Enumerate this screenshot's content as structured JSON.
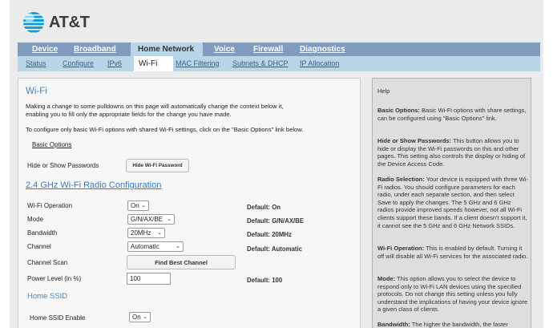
{
  "brand": {
    "name": "AT&T"
  },
  "nav_primary": [
    {
      "label": "Device",
      "active": false
    },
    {
      "label": "Broadband",
      "active": false
    },
    {
      "label": "Home Network",
      "active": true
    },
    {
      "label": "Voice",
      "active": false
    },
    {
      "label": "Firewall",
      "active": false
    },
    {
      "label": "Diagnostics",
      "active": false
    }
  ],
  "nav_secondary": [
    {
      "label": "Status",
      "active": false
    },
    {
      "label": "Configure",
      "active": false
    },
    {
      "label": "IPv6",
      "active": false
    },
    {
      "label": "Wi-Fi",
      "active": true
    },
    {
      "label": "MAC Filtering",
      "active": false
    },
    {
      "label": "Subnets & DHCP",
      "active": false
    },
    {
      "label": "IP Allocation",
      "active": false
    }
  ],
  "main": {
    "title": "Wi-Fi",
    "intro_line1": "Making a change to some pulldowns on this page will automatically change the context below it,",
    "intro_line2": "enabling you to fill only the appropriate fields for the change you have made.",
    "intro_line3": "To configure only basic Wi-Fi options with shared Wi-Fi settings, click on the \"Basic Options\" link below.",
    "basic_options_link": "Basic Options",
    "hide_show_label": "Hide or Show Passwords",
    "hide_password_button": "Hide Wi-Fi Password",
    "radio_section_title": "2.4 GHz Wi-Fi Radio Configuration",
    "radio_fields": {
      "operation": {
        "label": "Wi-Fi Operation",
        "value": "On",
        "default": "Default: On"
      },
      "mode": {
        "label": "Mode",
        "value": "G/N/AX/BE",
        "default": "Default: G/N/AX/BE"
      },
      "bandwidth": {
        "label": "Bandwidth",
        "value": "20MHz",
        "default": "Default: 20MHz"
      },
      "channel": {
        "label": "Channel",
        "value": "Automatic",
        "default": "Default: Automatic"
      },
      "channel_scan": {
        "label": "Channel Scan",
        "button": "Find Best Channel"
      },
      "power": {
        "label": "Power Level (in %)",
        "value": "100",
        "default": "Default: 100"
      }
    },
    "home_ssid_title": "Home SSID",
    "home_ssid_enable": {
      "label": "Home SSID Enable",
      "value": "On"
    }
  },
  "help": {
    "title": "Help",
    "basic_options_term": "Basic Options:",
    "basic_options_text": " Basic Wi-Fi options with share settings, can be configured using \"Basic Options\" link.",
    "hide_show_term": "Hide or Show Passwords:",
    "hide_show_text": " This button allows you to hide or display the Wi-Fi passwords on this and other pages. This setting also controls the display or hiding of the Device Access Code.",
    "radio_selection_term": "Radio Selection:",
    "radio_selection_text": " Your device is equipped with three Wi-Fi radios. You should configure parameters for each radio, under each separate section, and then select Save to apply the changes. The 5 GHz and 6 GHz radios provide improved speeds however, not all Wi-Fi clients support these bands. If a client doesn't support it, it cannot see the 5 GHz and 6 GHz Network SSIDs.",
    "wifi_operation_term": "Wi-Fi Operation:",
    "wifi_operation_text": " This is enabled by default. Turning it off will disable all Wi-Fi services for the associated radio.",
    "mode_term": "Mode:",
    "mode_text": " This option allows you to select the device to respond only to Wi-Fi LAN devices using the specified protocols. Do not change this setting unless you fully understand the implications of having your device ignore a given class of clients.",
    "bandwidth_term": "Bandwidth:",
    "bandwidth_text": " The higher the bandwidth, the faster"
  },
  "icons": {
    "brand_logo": "att-globe-icon",
    "select_arrow": "chevron-down-icon"
  },
  "colors": {
    "primary_nav": "#7f9bbd",
    "secondary_nav": "#b9d6e8",
    "heading": "#4a86b6"
  }
}
